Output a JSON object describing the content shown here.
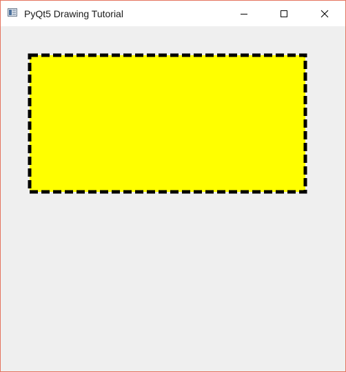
{
  "window": {
    "title": "PyQt5 Drawing Tutorial",
    "icon": "app-window-icon",
    "controls": {
      "minimize_icon": "minimize-icon",
      "maximize_icon": "maximize-icon",
      "close_icon": "close-icon"
    },
    "border_color": "#e5735e",
    "background_color": "#efefef"
  },
  "drawing": {
    "shape": "rectangle",
    "fill_color": "#ffff00",
    "stroke_color": "#000000",
    "stroke_style": "dashed"
  }
}
